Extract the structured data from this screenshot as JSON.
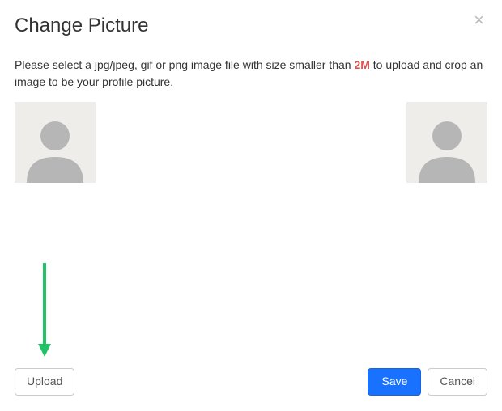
{
  "modal": {
    "title": "Change Picture",
    "description_before": "Please select a jpg/jpeg, gif or png image file with size smaller than ",
    "size_limit": "2M",
    "description_after": " to upload and crop an image to be your profile picture."
  },
  "buttons": {
    "upload": "Upload",
    "save": "Save",
    "cancel": "Cancel"
  }
}
